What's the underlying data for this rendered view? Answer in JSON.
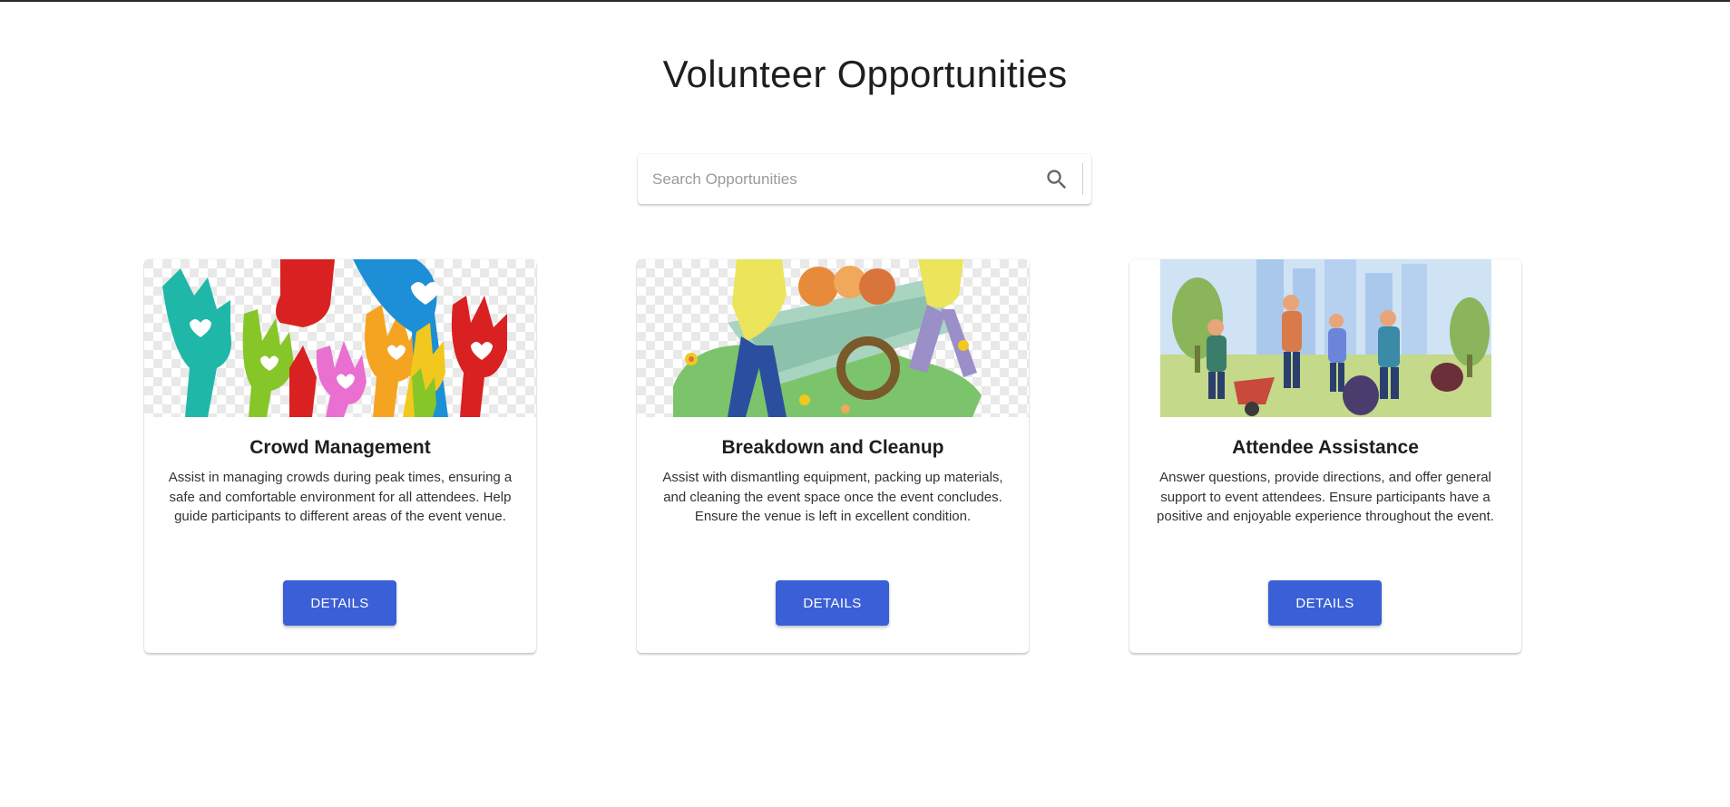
{
  "page": {
    "title": "Volunteer Opportunities"
  },
  "search": {
    "placeholder": "Search Opportunities",
    "icon": "search-icon"
  },
  "colors": {
    "button": "#3a5fd6",
    "title_text": "#1e1e1e"
  },
  "cards": [
    {
      "title": "Crowd Management",
      "description": "Assist in managing crowds during peak times, ensuring a safe and comfortable environment for all attendees. Help guide participants to different areas of the event venue.",
      "button_label": "DETAILS",
      "image": "colorful raised hands with hearts"
    },
    {
      "title": "Breakdown and Cleanup",
      "description": "Assist with dismantling equipment, packing up materials, and cleaning the event space once the event concludes. Ensure the venue is left in excellent condition.",
      "button_label": "DETAILS",
      "image": "people pushing a wheelbarrow"
    },
    {
      "title": "Attendee Assistance",
      "description": "Answer questions, provide directions, and offer general support to event attendees. Ensure participants have a positive and enjoyable experience throughout the event.",
      "button_label": "DETAILS",
      "image": "volunteers cleaning a city park"
    }
  ]
}
